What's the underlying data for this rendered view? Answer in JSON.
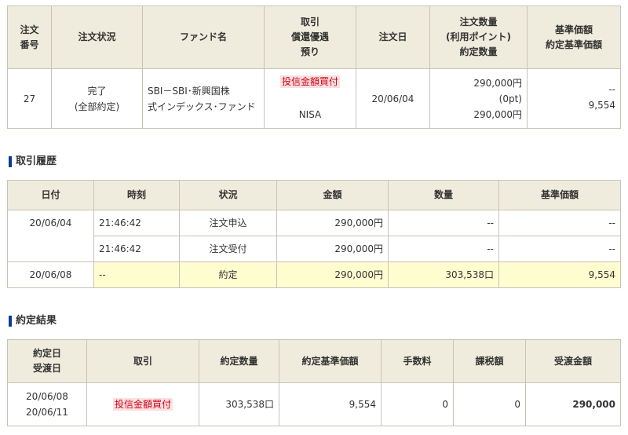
{
  "order_table": {
    "headers": {
      "order_no": [
        "注文",
        "番号"
      ],
      "status": "注文状況",
      "fund": "ファンド名",
      "trade": [
        "取引",
        "償還優遇",
        "預り"
      ],
      "order_date": "注文日",
      "quantity": [
        "注文数量",
        "(利用ポイント)",
        "約定数量"
      ],
      "base_price": [
        "基準価額",
        "約定基準価額"
      ]
    },
    "row": {
      "order_no": "27",
      "status": [
        "完了",
        "(全部約定)"
      ],
      "fund": [
        "SBI－SBI･新興国株",
        "式インデックス･ファンド"
      ],
      "trade_type": "投信金額買付",
      "account": "NISA",
      "order_date": "20/06/04",
      "quantity": [
        "290,000円",
        "(0pt)",
        "290,000円"
      ],
      "base_price": [
        "--",
        "9,554"
      ]
    }
  },
  "history": {
    "title": "取引履歴",
    "headers": [
      "日付",
      "時刻",
      "状況",
      "金額",
      "数量",
      "基準価額"
    ],
    "rows": [
      {
        "date": "20/06/04",
        "time": "21:46:42",
        "status": "注文申込",
        "amount": "290,000円",
        "qty": "--",
        "price": "--"
      },
      {
        "date": "",
        "time": "21:46:42",
        "status": "注文受付",
        "amount": "290,000円",
        "qty": "--",
        "price": "--"
      },
      {
        "date": "20/06/08",
        "time": "--",
        "status": "約定",
        "amount": "290,000円",
        "qty": "303,538口",
        "price": "9,554"
      }
    ]
  },
  "result": {
    "title": "約定結果",
    "headers": {
      "dates": [
        "約定日",
        "受渡日"
      ],
      "trade": "取引",
      "qty": "約定数量",
      "price": "約定基準価額",
      "fee": "手数料",
      "tax": "課税額",
      "amount": "受渡金額"
    },
    "row": {
      "dates": [
        "20/06/08",
        "20/06/11"
      ],
      "trade": "投信金額買付",
      "qty": "303,538口",
      "price": "9,554",
      "fee": "0",
      "tax": "0",
      "amount": "290,000"
    }
  },
  "colors": {
    "header_bg": "#f0ecdd",
    "border": "#c9c3b6",
    "highlight_row": "#fffdd0",
    "trade_tag_bg": "#fbe0e0",
    "trade_tag_text": "#d0021b",
    "section_bar": "#0b3d91"
  },
  "icons": [
    "section-bar-icon"
  ]
}
